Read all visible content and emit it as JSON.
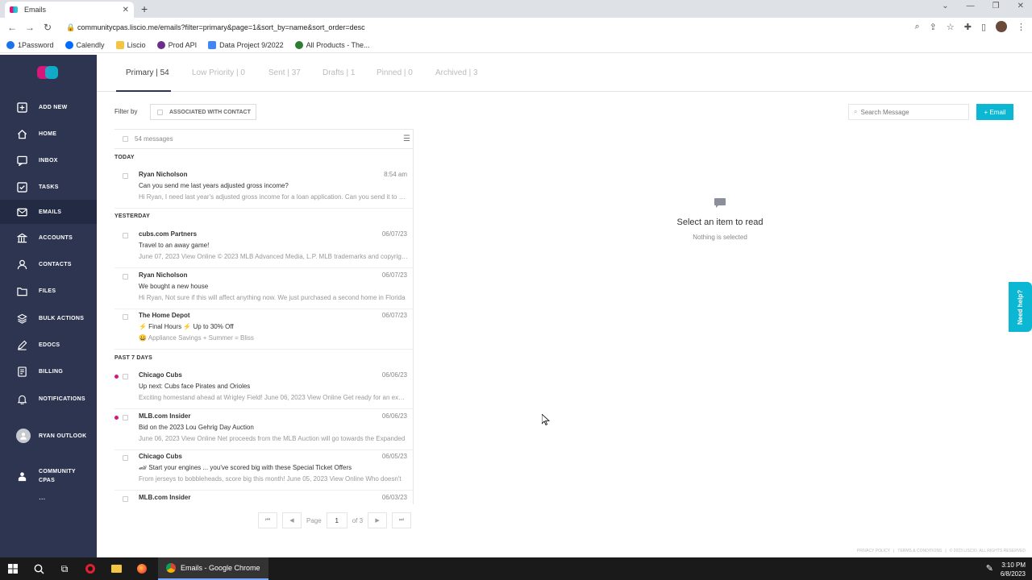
{
  "browser": {
    "tab_title": "Emails",
    "url": "communitycpas.liscio.me/emails?filter=primary&page=1&sort_by=name&sort_order=desc",
    "bookmarks": [
      {
        "label": "1Password",
        "color": "#1a73e8"
      },
      {
        "label": "Calendly",
        "color": "#006bff"
      },
      {
        "label": "Liscio",
        "color": "#f4c542"
      },
      {
        "label": "Prod API",
        "color": "#6b2e8a"
      },
      {
        "label": "Data Project 9/2022",
        "color": "#4285f4"
      },
      {
        "label": "All Products - The...",
        "color": "#2e7d32"
      }
    ]
  },
  "sidebar": {
    "items": [
      {
        "label": "ADD NEW",
        "icon": "plus-square-icon"
      },
      {
        "label": "HOME",
        "icon": "home-icon"
      },
      {
        "label": "INBOX",
        "icon": "inbox-icon"
      },
      {
        "label": "TASKS",
        "icon": "check-square-icon"
      },
      {
        "label": "EMAILS",
        "icon": "envelope-icon"
      },
      {
        "label": "ACCOUNTS",
        "icon": "accounts-icon"
      },
      {
        "label": "CONTACTS",
        "icon": "person-icon"
      },
      {
        "label": "FILES",
        "icon": "folder-icon"
      },
      {
        "label": "BULK ACTIONS",
        "icon": "layers-icon"
      },
      {
        "label": "EDOCS",
        "icon": "pen-icon"
      },
      {
        "label": "BILLING",
        "icon": "billing-icon"
      },
      {
        "label": "NOTIFICATIONS",
        "icon": "bell-icon"
      }
    ],
    "user": "RYAN OUTLOOK",
    "firm_line1": "COMMUNITY",
    "firm_line2": "CPAS",
    "more": "..."
  },
  "tabs": [
    "Primary | 54",
    "Low Priority | 0",
    "Sent | 37",
    "Drafts | 1",
    "Pinned | 0",
    "Archived | 3"
  ],
  "filter": {
    "label": "Filter by",
    "chip": "ASSOCIATED WITH CONTACT"
  },
  "search": {
    "placeholder": "Search Message"
  },
  "email_button": "+ Email",
  "list": {
    "count": "54 messages",
    "groups": {
      "today": "TODAY",
      "yesterday": "YESTERDAY",
      "past7": "PAST 7 DAYS"
    },
    "rows": [
      {
        "sender": "Ryan Nicholson",
        "date": "8:54 am",
        "subject": "Can you send me last years adjusted gross income?",
        "preview": "Hi Ryan, I need last year's adjusted gross income for a loan application. Can you send it to me?",
        "unread": false
      },
      {
        "sender": "cubs.com Partners",
        "date": "06/07/23",
        "subject": "Travel to an away game!",
        "preview": "June 07, 2023 View Online © 2023 MLB Advanced Media, L.P. MLB trademarks and copyrights",
        "unread": false
      },
      {
        "sender": "Ryan Nicholson",
        "date": "06/07/23",
        "subject": "We bought a new house",
        "preview": "Hi Ryan, Not sure if this will affect anything now. We just purchased a second home in Florida",
        "unread": false
      },
      {
        "sender": "The Home Depot",
        "date": "06/07/23",
        "subject": "⚡ Final Hours ⚡ Up to 30% Off",
        "preview": "😀 Appliance Savings + Summer = Bliss",
        "unread": false
      },
      {
        "sender": "Chicago Cubs",
        "date": "06/06/23",
        "subject": "Up next: Cubs face Pirates and Orioles",
        "preview": "Exciting homestand ahead at Wrigley Field! June 06, 2023 View Online Get ready for an exciting",
        "unread": true
      },
      {
        "sender": "MLB.com Insider",
        "date": "06/06/23",
        "subject": "Bid on the 2023 Lou Gehrig Day Auction",
        "preview": "June 06, 2023 View Online Net proceeds from the MLB Auction will go towards the Expanded",
        "unread": true
      },
      {
        "sender": "Chicago Cubs",
        "date": "06/05/23",
        "subject": "🏎 Start your engines ... you've scored big with these Special Ticket Offers",
        "preview": "From jerseys to bobbleheads, score big this month! June 05, 2023 View Online Who doesn't",
        "unread": false
      },
      {
        "sender": "MLB.com Insider",
        "date": "06/03/23",
        "subject": "",
        "preview": "",
        "unread": false
      }
    ]
  },
  "pager": {
    "first": "⏮",
    "prev": "◀",
    "label": "Page",
    "page": "1",
    "of": "of 3",
    "next": "▶",
    "last": "⏭"
  },
  "empty": {
    "title": "Select an item to read",
    "subtitle": "Nothing is selected"
  },
  "need_help": "Need help?",
  "footer": [
    "PRIVACY POLICY",
    "|",
    "TERMS & CONDITIONS",
    "|",
    "© 2023 LISCIO. ALL RIGHTS RESERVED"
  ],
  "taskbar": {
    "app": "Emails - Google Chrome",
    "time": "3:10 PM",
    "date": "6/8/2023"
  },
  "colors": {
    "sidebar": "#2e3551",
    "accent": "#0cb7d4",
    "unread": "#d6187a"
  }
}
